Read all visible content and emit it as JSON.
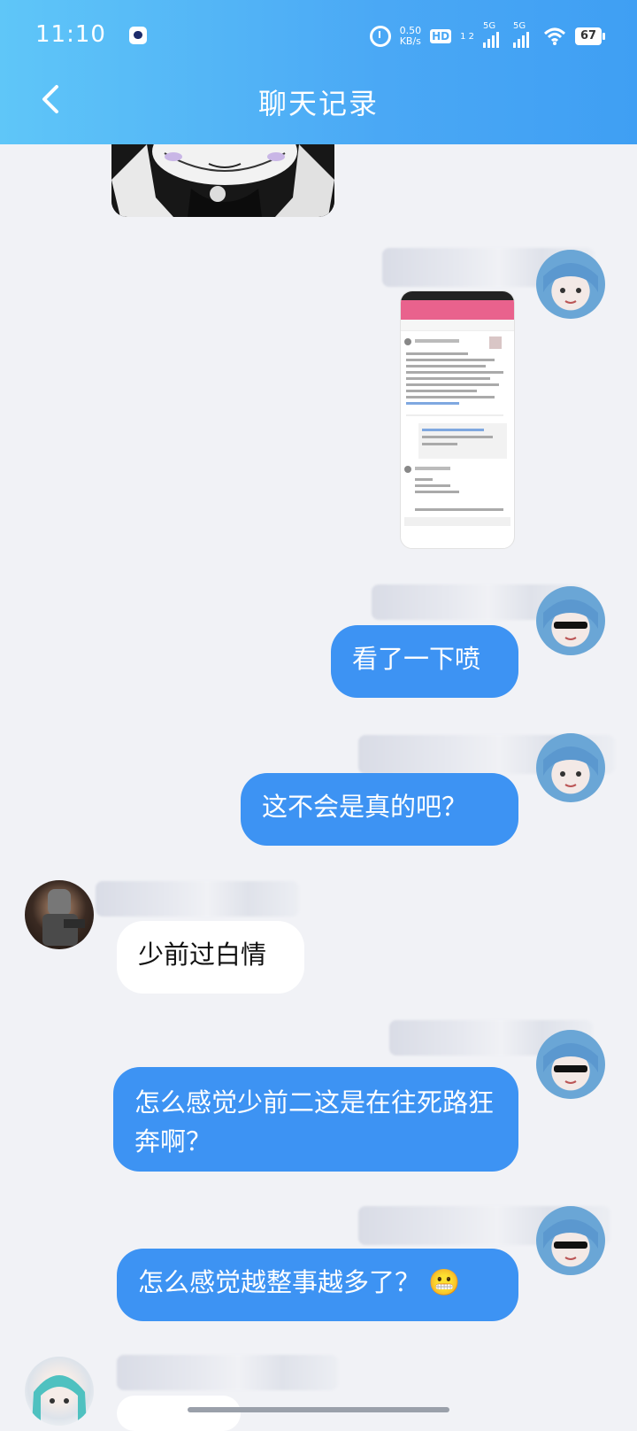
{
  "status_bar": {
    "time": "11:10",
    "net_speed_value": "0.50",
    "net_speed_unit": "KB/s",
    "hd_label": "HD",
    "hd_sub": "1 2",
    "signal1_label": "5G",
    "signal2_label": "5G",
    "battery": "67"
  },
  "header": {
    "title": "聊天记录"
  },
  "messages": [
    {
      "side": "me",
      "text": "看了一下喷"
    },
    {
      "side": "me",
      "text": "这不会是真的吧？"
    },
    {
      "side": "other",
      "text": "少前过白情"
    },
    {
      "side": "me",
      "text": "怎么感觉少前二这是在往死路狂奔啊？"
    },
    {
      "side": "me",
      "text": "怎么感觉越整事越多了？",
      "emoji": "😬"
    }
  ],
  "colors": {
    "header_gradient_start": "#5fc6f8",
    "header_gradient_end": "#3f9ff3",
    "my_bubble": "#3d93f3",
    "their_bubble": "#ffffff",
    "background": "#f1f2f6"
  },
  "icons": {
    "back": "chevron-left-icon",
    "alarm": "alarm-icon",
    "wifi": "wifi-icon"
  }
}
